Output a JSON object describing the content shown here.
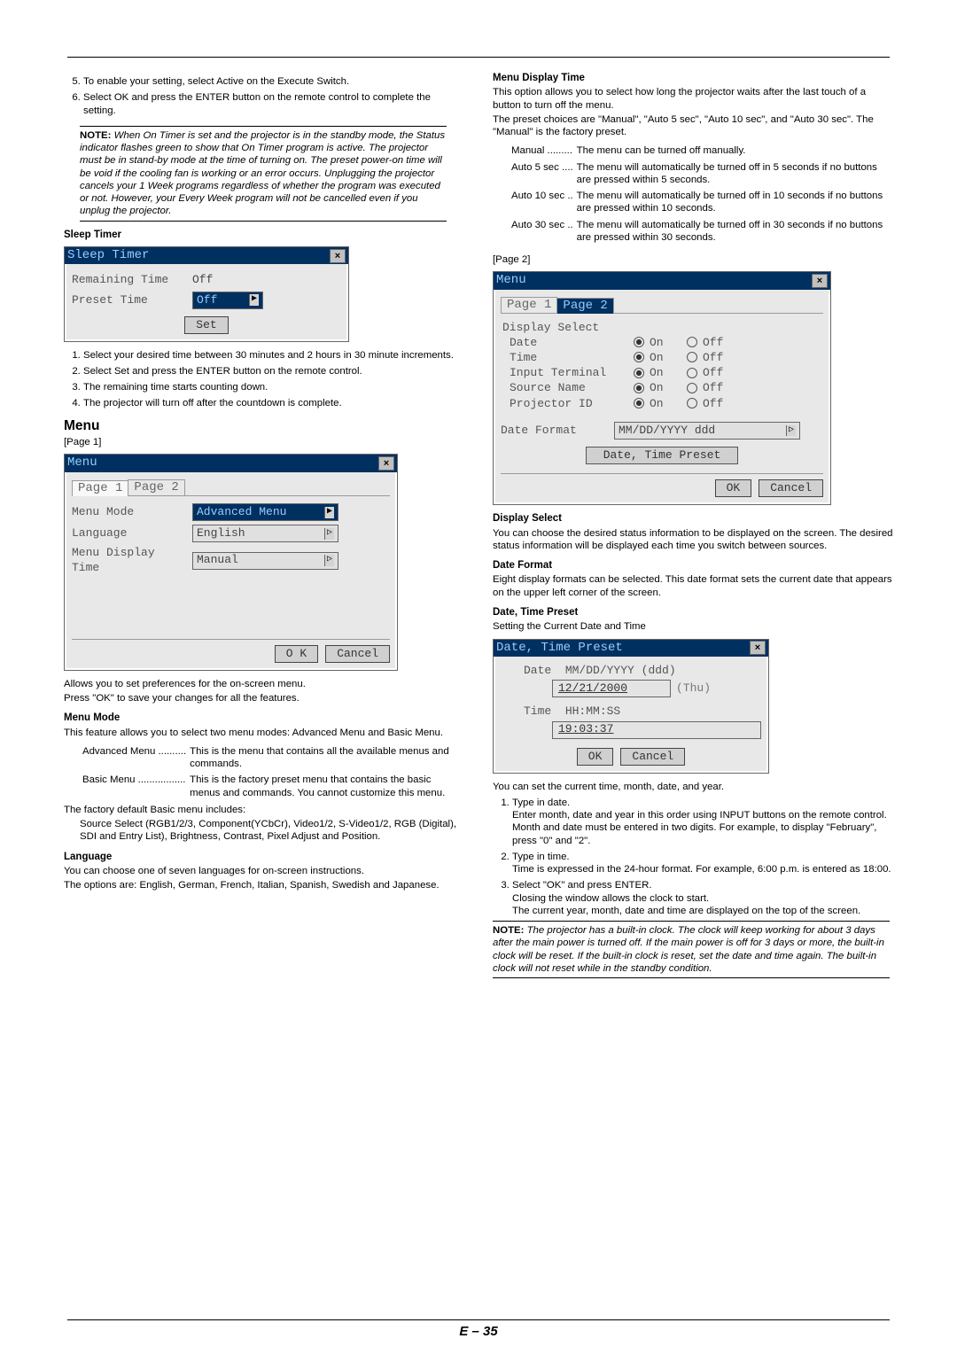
{
  "left": {
    "steps_top": [
      "To enable your setting, select Active on the Execute Switch.",
      "Select OK and press the ENTER button on the remote control to complete the setting."
    ],
    "note_label": "NOTE:",
    "note": " When On Timer is set and the projector is in the standby mode, the Status indicator flashes green to show that On Timer program is active. The projector must be in stand-by mode at the time of turning on. The preset power-on time will be void if the cooling fan is working or an error occurs. Unplugging the projector cancels your 1 Week programs regardless of whether the program was executed or not. However, your Every Week program will not be cancelled even if you unplug the projector.",
    "sleep_timer_h": "Sleep Timer",
    "ui_sleep": {
      "title": "Sleep Timer",
      "remaining_lbl": "Remaining Time",
      "remaining_val": "Off",
      "preset_lbl": "Preset Time",
      "preset_val": "Off",
      "set_btn": "Set"
    },
    "sleep_steps": [
      "Select your desired time between 30 minutes and 2 hours in 30 minute increments.",
      "Select Set and press the ENTER button on the remote control.",
      "The remaining time starts counting down.",
      "The projector will turn off after the countdown is complete."
    ],
    "menu_h": "Menu",
    "page1_label": "[Page 1]",
    "ui_menu": {
      "title": "Menu",
      "tab1": "Page 1",
      "tab2": "Page 2",
      "mode_lbl": "Menu Mode",
      "mode_val": "Advanced Menu",
      "lang_lbl": "Language",
      "lang_val": "English",
      "disp_lbl": "Menu Display Time",
      "disp_val": "Manual",
      "ok": "O K",
      "cancel": "Cancel"
    },
    "menu_desc1": "Allows you to set preferences for the on-screen menu.",
    "menu_desc2": "Press \"OK\" to save your changes for all the features.",
    "menu_mode_h": "Menu Mode",
    "menu_mode_p": "This feature allows you to select two menu modes: Advanced Menu and Basic Menu.",
    "adv_lbl": "Advanced Menu ..........",
    "adv_txt": "This is the menu that contains all the available menus and commands.",
    "basic_lbl": "Basic Menu .................",
    "basic_txt": "This is the factory preset menu that contains the basic menus and commands. You cannot customize this menu.",
    "default_p": "The factory default Basic menu includes:",
    "default_list": "Source Select (RGB1/2/3, Component(YCbCr), Video1/2, S-Video1/2, RGB (Digital), SDI and Entry List), Brightness, Contrast, Pixel Adjust and Position.",
    "lang_h": "Language",
    "lang_p1": "You can choose one of seven languages for on-screen instructions.",
    "lang_p2": "The options are: English, German, French, Italian, Spanish, Swedish and Japanese."
  },
  "right": {
    "mdt_h": "Menu Display Time",
    "mdt_p1": "This option allows you to select how long the projector waits after the last touch of a button to turn off the menu.",
    "mdt_p2": "The preset choices are \"Manual\", \"Auto 5 sec\", \"Auto 10 sec\", and \"Auto 30 sec\". The \"Manual\" is the factory preset.",
    "mdt_rows": [
      {
        "k": "Manual .........",
        "v": "The menu can be turned off manually."
      },
      {
        "k": "Auto 5 sec ....",
        "v": "The menu will automatically be turned off in 5 seconds if no buttons are pressed within 5 seconds."
      },
      {
        "k": "Auto 10 sec ..",
        "v": "The menu will automatically be turned off in 10 seconds if no buttons are pressed within 10 seconds."
      },
      {
        "k": "Auto 30 sec ..",
        "v": "The menu will automatically be turned off in 30 seconds if no buttons are pressed within 30 seconds."
      }
    ],
    "page2_label": "[Page 2]",
    "ui_menu2": {
      "title": "Menu",
      "tab1": "Page 1",
      "tab2": "Page 2",
      "ds_lbl": "Display Select",
      "items": [
        "Date",
        "Time",
        "Input Terminal",
        "Source Name",
        "Projector ID"
      ],
      "on": "On",
      "off": "Off",
      "df_lbl": "Date Format",
      "df_val": "MM/DD/YYYY ddd",
      "preset_btn": "Date, Time Preset",
      "ok": "OK",
      "cancel": "Cancel"
    },
    "ds_h": "Display Select",
    "ds_p": "You can choose the desired status information to be displayed on the screen. The desired status information will be displayed each time you switch between sources.",
    "df_h": "Date Format",
    "df_p": "Eight display formats can be selected. This date format sets the current date that appears on the upper left corner of the screen.",
    "dtp_h": "Date, Time Preset",
    "dtp_sub": "Setting the Current Date and Time",
    "ui_dtp": {
      "title": "Date, Time Preset",
      "date_lbl": "Date",
      "date_fmt": "MM/DD/YYYY (ddd)",
      "date_val": "12/21/2000",
      "date_dow": "(Thu)",
      "time_lbl": "Time",
      "time_fmt": "HH:MM:SS",
      "time_val": "19:03:37",
      "ok": "OK",
      "cancel": "Cancel"
    },
    "dtp_p": "You can set the current time, month, date, and year.",
    "dtp_steps": [
      {
        "h": "Type in date.",
        "b": [
          "Enter month, date and year in this order using INPUT buttons on the remote control.",
          "Month and date must be entered in two digits. For example, to display \"February\", press \"0\" and \"2\"."
        ]
      },
      {
        "h": "Type in time.",
        "b": [
          "Time is expressed in the 24-hour format. For example, 6:00 p.m. is entered as 18:00."
        ]
      },
      {
        "h": "Select \"OK\" and press ENTER.",
        "b": [
          "Closing the window allows the clock to start.",
          "The current year, month, date and time are displayed on the top of the screen."
        ]
      }
    ],
    "note_label": "NOTE:",
    "note": " The projector has a built-in clock. The clock will keep working for about 3 days after the main power is turned off. If the main power is off for 3 days or more, the built-in clock will be reset. If the built-in clock is reset, set the date and time again. The built-in clock will not reset while in the standby condition."
  },
  "footer": "E – 35"
}
